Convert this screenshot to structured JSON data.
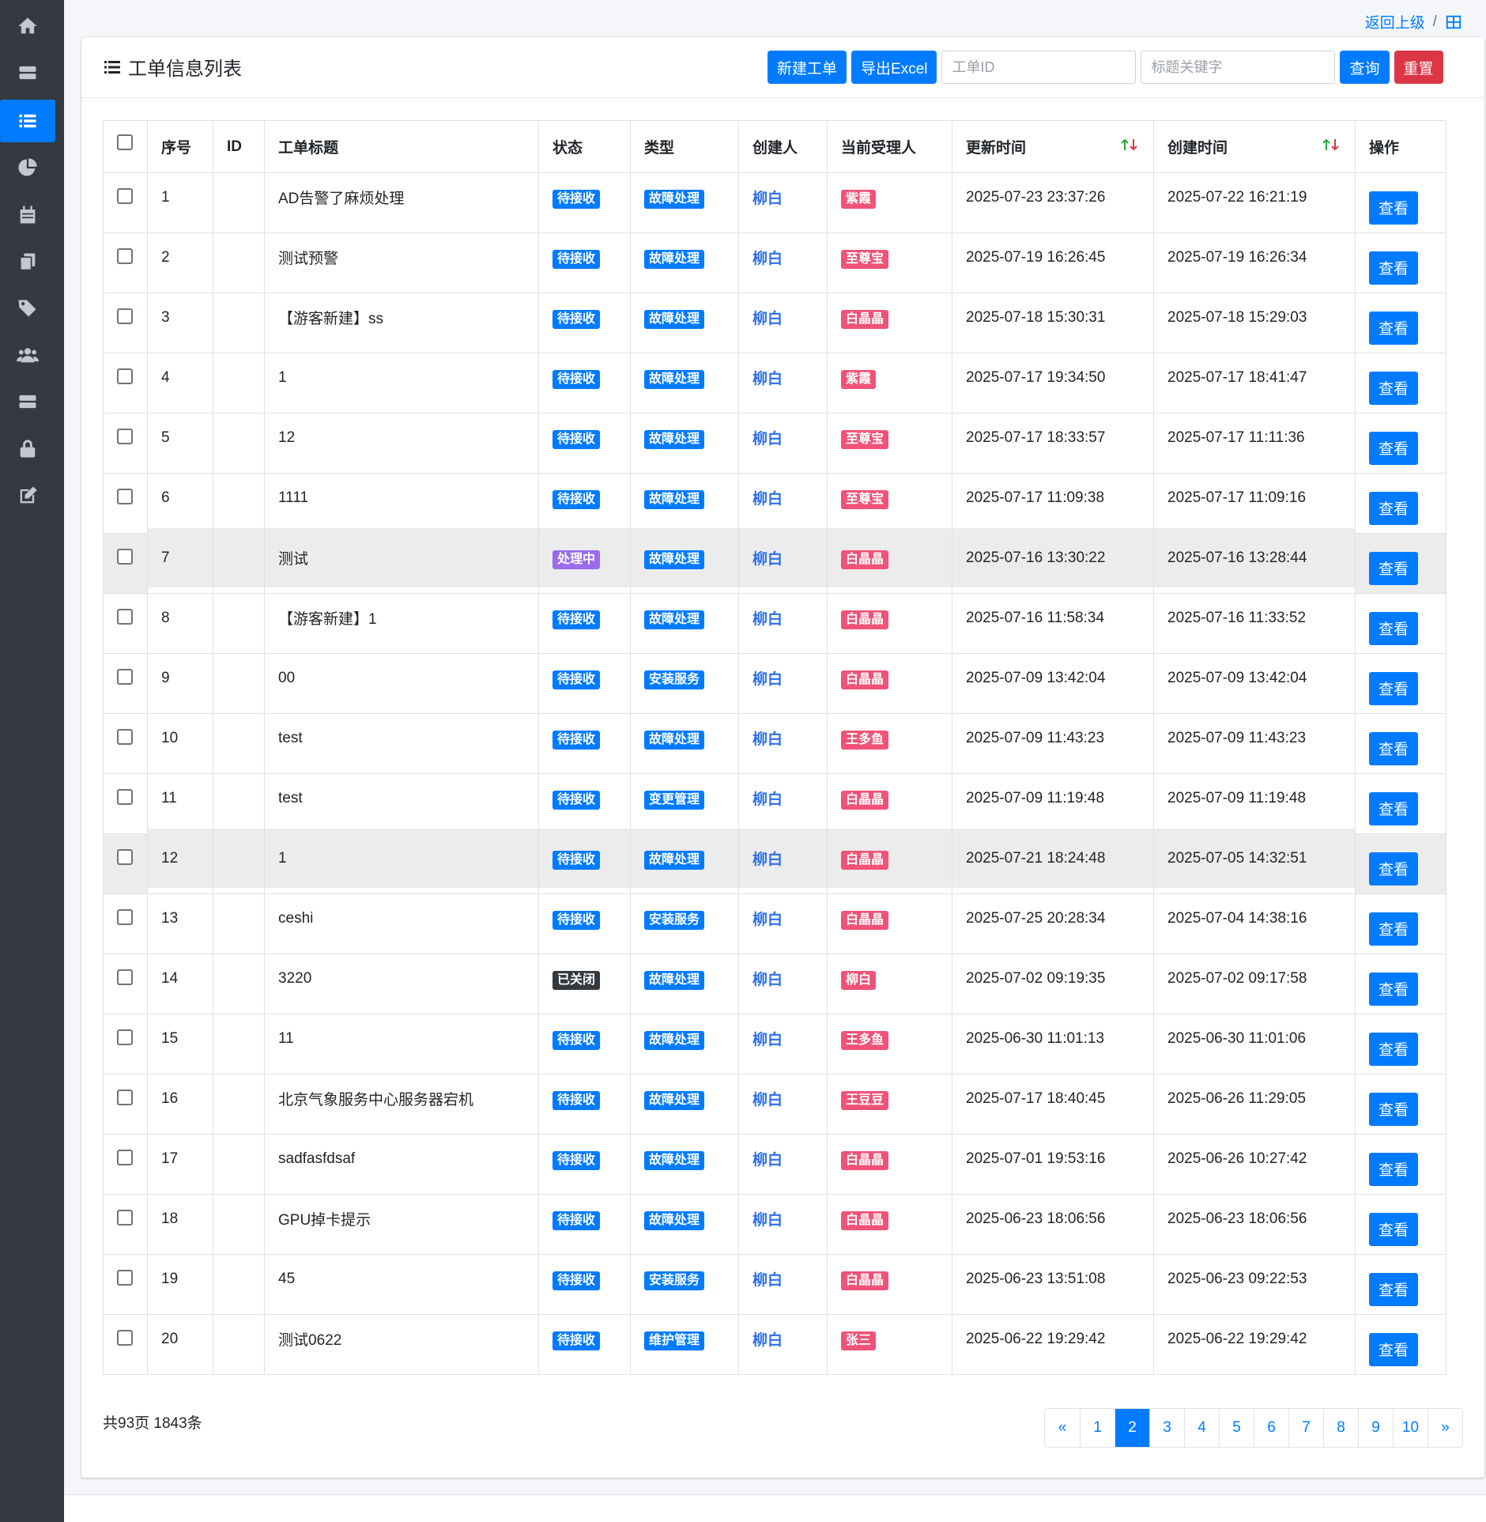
{
  "breadcrumb": {
    "back_label": "返回上级",
    "separator": "/"
  },
  "page": {
    "title": "工单信息列表"
  },
  "toolbar": {
    "new_label": "新建工单",
    "export_label": "导出Excel",
    "id_placeholder": "工单ID",
    "keyword_placeholder": "标题关键字",
    "search_label": "查询",
    "reset_label": "重置"
  },
  "sidebar": {
    "items": [
      "home-icon",
      "server-icon",
      "list-icon",
      "chart-pie-icon",
      "calendar-icon",
      "copy-icon",
      "tags-icon",
      "users-icon",
      "database-icon",
      "lock-icon",
      "edit-icon"
    ],
    "active": "list-icon"
  },
  "table": {
    "columns": [
      "",
      "序号",
      "ID",
      "工单标题",
      "状态",
      "类型",
      "创建人",
      "当前受理人",
      "更新时间",
      "创建时间",
      "操作"
    ],
    "view_label": "查看",
    "rows": [
      {
        "no": "1",
        "id": "",
        "title": "AD告警了麻烦处理",
        "status": "待接收",
        "type": "故障处理",
        "creator": "柳白",
        "assignee": "紫霞",
        "updated": "2025-07-23 23:37:26",
        "created": "2025-07-22 16:21:19"
      },
      {
        "no": "2",
        "id": "",
        "title": "测试预警",
        "status": "待接收",
        "type": "故障处理",
        "creator": "柳白",
        "assignee": "至尊宝",
        "updated": "2025-07-19 16:26:45",
        "created": "2025-07-19 16:26:34"
      },
      {
        "no": "3",
        "id": "",
        "title": "【游客新建】ss",
        "status": "待接收",
        "type": "故障处理",
        "creator": "柳白",
        "assignee": "白晶晶",
        "updated": "2025-07-18 15:30:31",
        "created": "2025-07-18 15:29:03"
      },
      {
        "no": "4",
        "id": "",
        "title": "1",
        "status": "待接收",
        "type": "故障处理",
        "creator": "柳白",
        "assignee": "紫霞",
        "updated": "2025-07-17 19:34:50",
        "created": "2025-07-17 18:41:47"
      },
      {
        "no": "5",
        "id": "",
        "title": "12",
        "status": "待接收",
        "type": "故障处理",
        "creator": "柳白",
        "assignee": "至尊宝",
        "updated": "2025-07-17 18:33:57",
        "created": "2025-07-17 11:11:36"
      },
      {
        "no": "6",
        "id": "",
        "title": "1111",
        "status": "待接收",
        "type": "故障处理",
        "creator": "柳白",
        "assignee": "至尊宝",
        "updated": "2025-07-17 11:09:38",
        "created": "2025-07-17 11:09:16"
      },
      {
        "no": "7",
        "id": "",
        "title": "测试",
        "status": "处理中",
        "type": "故障处理",
        "creator": "柳白",
        "assignee": "白晶晶",
        "updated": "2025-07-16 13:30:22",
        "created": "2025-07-16 13:28:44"
      },
      {
        "no": "8",
        "id": "",
        "title": "【游客新建】1",
        "status": "待接收",
        "type": "故障处理",
        "creator": "柳白",
        "assignee": "白晶晶",
        "updated": "2025-07-16 11:58:34",
        "created": "2025-07-16 11:33:52"
      },
      {
        "no": "9",
        "id": "",
        "title": "00",
        "status": "待接收",
        "type": "安装服务",
        "creator": "柳白",
        "assignee": "白晶晶",
        "updated": "2025-07-09 13:42:04",
        "created": "2025-07-09 13:42:04"
      },
      {
        "no": "10",
        "id": "",
        "title": "test",
        "status": "待接收",
        "type": "故障处理",
        "creator": "柳白",
        "assignee": "王多鱼",
        "updated": "2025-07-09 11:43:23",
        "created": "2025-07-09 11:43:23"
      },
      {
        "no": "11",
        "id": "",
        "title": "test",
        "status": "待接收",
        "type": "变更管理",
        "creator": "柳白",
        "assignee": "白晶晶",
        "updated": "2025-07-09 11:19:48",
        "created": "2025-07-09 11:19:48"
      },
      {
        "no": "12",
        "id": "",
        "title": "1",
        "status": "待接收",
        "type": "故障处理",
        "creator": "柳白",
        "assignee": "白晶晶",
        "updated": "2025-07-21 18:24:48",
        "created": "2025-07-05 14:32:51"
      },
      {
        "no": "13",
        "id": "",
        "title": "ceshi",
        "status": "待接收",
        "type": "安装服务",
        "creator": "柳白",
        "assignee": "白晶晶",
        "updated": "2025-07-25 20:28:34",
        "created": "2025-07-04 14:38:16"
      },
      {
        "no": "14",
        "id": "",
        "title": "3220",
        "status": "已关闭",
        "type": "故障处理",
        "creator": "柳白",
        "assignee": "柳白",
        "updated": "2025-07-02 09:19:35",
        "created": "2025-07-02 09:17:58"
      },
      {
        "no": "15",
        "id": "",
        "title": "11",
        "status": "待接收",
        "type": "故障处理",
        "creator": "柳白",
        "assignee": "王多鱼",
        "updated": "2025-06-30 11:01:13",
        "created": "2025-06-30 11:01:06"
      },
      {
        "no": "16",
        "id": "",
        "title": "北京气象服务中心服务器宕机",
        "status": "待接收",
        "type": "故障处理",
        "creator": "柳白",
        "assignee": "王豆豆",
        "updated": "2025-07-17 18:40:45",
        "created": "2025-06-26 11:29:05"
      },
      {
        "no": "17",
        "id": "",
        "title": "sadfasfdsaf",
        "status": "待接收",
        "type": "故障处理",
        "creator": "柳白",
        "assignee": "白晶晶",
        "updated": "2025-07-01 19:53:16",
        "created": "2025-06-26 10:27:42"
      },
      {
        "no": "18",
        "id": "",
        "title": "GPU掉卡提示",
        "status": "待接收",
        "type": "故障处理",
        "creator": "柳白",
        "assignee": "白晶晶",
        "updated": "2025-06-23 18:06:56",
        "created": "2025-06-23 18:06:56"
      },
      {
        "no": "19",
        "id": "",
        "title": "45",
        "status": "待接收",
        "type": "安装服务",
        "creator": "柳白",
        "assignee": "白晶晶",
        "updated": "2025-06-23 13:51:08",
        "created": "2025-06-23 09:22:53"
      },
      {
        "no": "20",
        "id": "",
        "title": "测试0622",
        "status": "待接收",
        "type": "维护管理",
        "creator": "柳白",
        "assignee": "张三",
        "updated": "2025-06-22 19:29:42",
        "created": "2025-06-22 19:29:42"
      }
    ],
    "highlighted_rows": [
      "7",
      "12"
    ]
  },
  "pagination": {
    "summary": "共93页 1843条",
    "prev": "«",
    "next": "»",
    "pages": [
      "1",
      "2",
      "3",
      "4",
      "5",
      "6",
      "7",
      "8",
      "9",
      "10"
    ],
    "current": "2"
  },
  "colors": {
    "primary": "#007bff",
    "danger": "#dc3545",
    "status_pending": "#007bff",
    "status_processing": "#9a6bef",
    "status_closed": "#343a40",
    "assignee_badge": "#f05377",
    "sidebar_bg": "#343a40"
  }
}
